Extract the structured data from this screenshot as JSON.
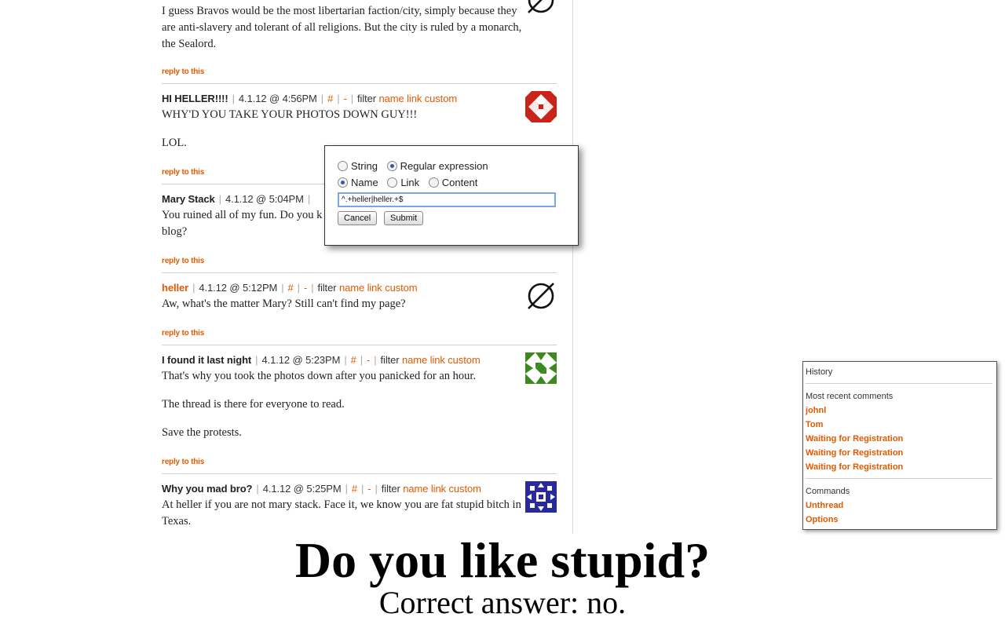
{
  "comments": [
    {
      "author": "",
      "body": [
        "I guess Bravos would be the most libertarian faction/city, simply because they are anti-slavery and tolerant of all religions. But the city is ruled by a monarch, the Sealord."
      ],
      "reply": "reply to this",
      "avatar": "null-avatar-icon"
    },
    {
      "author": "HI HELLER!!!!",
      "date": "4.1.12 @ 4:56PM",
      "hash": "#",
      "dash": "-",
      "filter_label": "filter",
      "filter_links": "name link custom",
      "body": [
        "WHY'D YOU TAKE YOUR PHOTOS DOWN GUY!!!",
        "LOL."
      ],
      "reply": "reply to this",
      "avatar": "red-identicon"
    },
    {
      "author": "Mary Stack",
      "date": "4.1.12 @ 5:04PM",
      "body": [
        "You ruined all of my fun. Do you k",
        "blog?"
      ],
      "reply": "reply to this"
    },
    {
      "author": "heller",
      "date": "4.1.12 @ 5:12PM",
      "hash": "#",
      "dash": "-",
      "filter_label": "filter",
      "filter_links": "name link custom",
      "body": [
        "Aw, what's the matter Mary? Still can't find my page?"
      ],
      "reply": "reply to this",
      "avatar": "null-avatar-icon"
    },
    {
      "author": "I found it last night",
      "date": "4.1.12 @ 5:23PM",
      "hash": "#",
      "dash": "-",
      "filter_label": "filter",
      "filter_links": "name link custom",
      "body": [
        "That's why you took the photos down after you panicked for an hour.",
        "The thread is there for everyone to read.",
        "Save the protests."
      ],
      "reply": "reply to this",
      "avatar": "green-identicon"
    },
    {
      "author": "Why you mad bro?",
      "date": "4.1.12 @ 5:25PM",
      "hash": "#",
      "dash": "-",
      "filter_label": "filter",
      "filter_links": "name link custom",
      "body": [
        "At heller if you are not mary stack. Face it, we know you are fat stupid bitch in Texas."
      ],
      "avatar": "blue-identicon"
    }
  ],
  "filter_popup": {
    "type_options": [
      {
        "label": "String",
        "selected": false
      },
      {
        "label": "Regular expression",
        "selected": true
      }
    ],
    "field_options": [
      {
        "label": "Name",
        "selected": true
      },
      {
        "label": "Link",
        "selected": false
      },
      {
        "label": "Content",
        "selected": false
      }
    ],
    "pattern_value": "^.+heller|heller.+$",
    "cancel_label": "Cancel",
    "submit_label": "Submit"
  },
  "side_panel": {
    "title": "History",
    "recent_heading": "Most recent comments",
    "recent": [
      "johnl",
      "Tom",
      "Waiting for Registration",
      "Waiting for Registration",
      "Waiting for Registration"
    ],
    "commands_heading": "Commands",
    "commands": [
      "Unthread",
      "Options"
    ]
  },
  "caption": {
    "main": "Do you like stupid?",
    "sub": "Correct answer: no."
  },
  "colors": {
    "accent": "#e05a00",
    "identicon_red": "#c8241a",
    "identicon_green": "#3c8a1e",
    "identicon_blue": "#2a2aa0"
  }
}
